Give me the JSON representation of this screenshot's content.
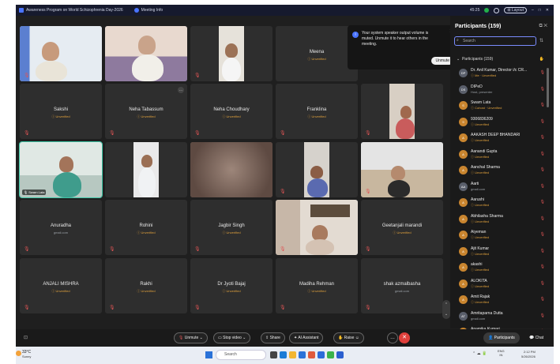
{
  "titlebar": {
    "meeting_title": "Awareness Program on World Schizophrenia Day-2026",
    "meeting_info": "Meeting Info",
    "timer": "45:25",
    "layout_label": "Layout",
    "minimize": "–",
    "maximize": "□",
    "close": "✕"
  },
  "notification": {
    "message": "Your system speaker output volume is muted. Unmute it to hear others in the meeting.",
    "button": "Unmute"
  },
  "tiles": [
    {
      "name": "",
      "status": ""
    },
    {
      "name": "",
      "status": ""
    },
    {
      "name": "",
      "status": ""
    },
    {
      "name": "Meena",
      "status": "Unverified"
    },
    {
      "name": "Sakshi",
      "status": "Unverified"
    },
    {
      "name": "Neha Tabassum",
      "status": "Unverified"
    },
    {
      "name": "Neha Choudhary",
      "status": "Unverified"
    },
    {
      "name": "Franklina",
      "status": "Unverified"
    },
    {
      "name": "Swarn Lata",
      "status": ""
    },
    {
      "name": "Anuradha",
      "status": "gmail.com"
    },
    {
      "name": "Rohini",
      "status": "Unverified"
    },
    {
      "name": "Jagbir Singh",
      "status": "Unverified"
    },
    {
      "name": "Geetanjali marandi",
      "status": "Unverified"
    },
    {
      "name": "ANJALI MISHRA",
      "status": "Unverified"
    },
    {
      "name": "Rakhi",
      "status": "Unverified"
    },
    {
      "name": "Dr Jyoti Bajaj",
      "status": "Unverified"
    },
    {
      "name": "Madiha Rehman",
      "status": "Unverified"
    },
    {
      "name": "shak azmalbasha",
      "status": "gmail.com"
    }
  ],
  "panel": {
    "title": "Participants (159)",
    "search_placeholder": "Search",
    "group_label": "Participants (159)",
    "participants": [
      {
        "initials": "DP",
        "name": "Dr. Anil Kumar, Director i/c CR...",
        "status": "Me · Unverified",
        "color": "#5a5f6b"
      },
      {
        "initials": "DS",
        "name": "DIPeD",
        "status": "Host, presenter",
        "color": "#5a5f6b"
      },
      {
        "initials": "S",
        "name": "Swarn Lata",
        "status": "Cohost · Unverified",
        "color": "#c9852f"
      },
      {
        "initials": "9",
        "name": "9306836209",
        "status": "Unverified",
        "color": "#c9852f"
      },
      {
        "initials": "A",
        "name": "AAKASH DEEP BHANDARI",
        "status": "Unverified",
        "color": "#c9852f"
      },
      {
        "initials": "A",
        "name": "Aanandi Gupta",
        "status": "Unverified",
        "color": "#c9852f"
      },
      {
        "initials": "A",
        "name": "Aanchal Sharma",
        "status": "Unverified",
        "color": "#c9852f"
      },
      {
        "initials": "AA",
        "name": "Aarti",
        "status": "gmail.com",
        "color": "#5a5f6b"
      },
      {
        "initials": "A",
        "name": "Aarushi",
        "status": "Unverified",
        "color": "#c9852f"
      },
      {
        "initials": "A",
        "name": "Abhilasha Sharma",
        "status": "Unverified",
        "color": "#c9852f"
      },
      {
        "initials": "A",
        "name": "Aiyeman",
        "status": "Unverified",
        "color": "#c9852f"
      },
      {
        "initials": "A",
        "name": "Ajit Kumar",
        "status": "Unverified",
        "color": "#c9852f"
      },
      {
        "initials": "A",
        "name": "akashi",
        "status": "Unverified",
        "color": "#c9852f"
      },
      {
        "initials": "A",
        "name": "ALOKITA",
        "status": "Unverified",
        "color": "#c9852f"
      },
      {
        "initials": "A",
        "name": "Amit Rajak",
        "status": "Unverified",
        "color": "#c9852f"
      },
      {
        "initials": "AT",
        "name": "Amritaparna Dutta",
        "status": "gmail.com",
        "color": "#5a5f6b"
      },
      {
        "initials": "A",
        "name": "Anamika Kumari",
        "status": "",
        "color": "#c9852f"
      }
    ]
  },
  "controls": {
    "unmute": "Unmute",
    "stop_video": "Stop video",
    "share": "Share",
    "ai_assistant": "AI Assistant",
    "raise": "Raise",
    "participants": "Participants",
    "chat": "Chat"
  },
  "taskbar": {
    "temp": "33°C",
    "weather": "Sunny",
    "search": "Search",
    "lang": "ENG",
    "lang_region": "IN",
    "time": "2:12 PM",
    "date": "5/26/2026"
  }
}
